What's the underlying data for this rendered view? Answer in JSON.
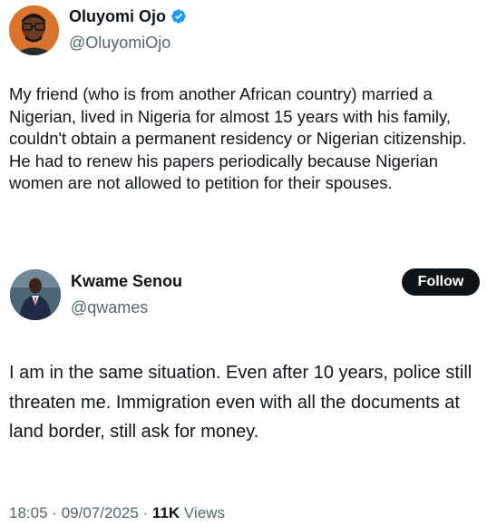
{
  "quoted_tweet": {
    "author_name": "Oluyomi Ojo",
    "author_handle": "@OluyomiOjo",
    "verified_icon": "verified-badge-icon",
    "text": "My friend (who is from another African country) married a Nigerian, lived in Nigeria for almost 15 years with his family, couldn't obtain a permanent residency or Nigerian citizenship. He had to renew his papers periodically because Nigerian women are not allowed to petition for their spouses."
  },
  "reply_tweet": {
    "author_name": "Kwame Senou",
    "author_handle": "@qwames",
    "follow_label": "Follow",
    "text": "I am in the same situation. Even after 10 years, police still threaten me. Immigration even with all the documents at land border, still ask for money.",
    "time": "18:05",
    "separator": "·",
    "date": "09/07/2025",
    "views_count": "11K",
    "views_label": "Views"
  },
  "colors": {
    "text": "#0f1419",
    "secondary": "#536471",
    "verified": "#1d9bf0",
    "button_bg": "#0f1419"
  }
}
